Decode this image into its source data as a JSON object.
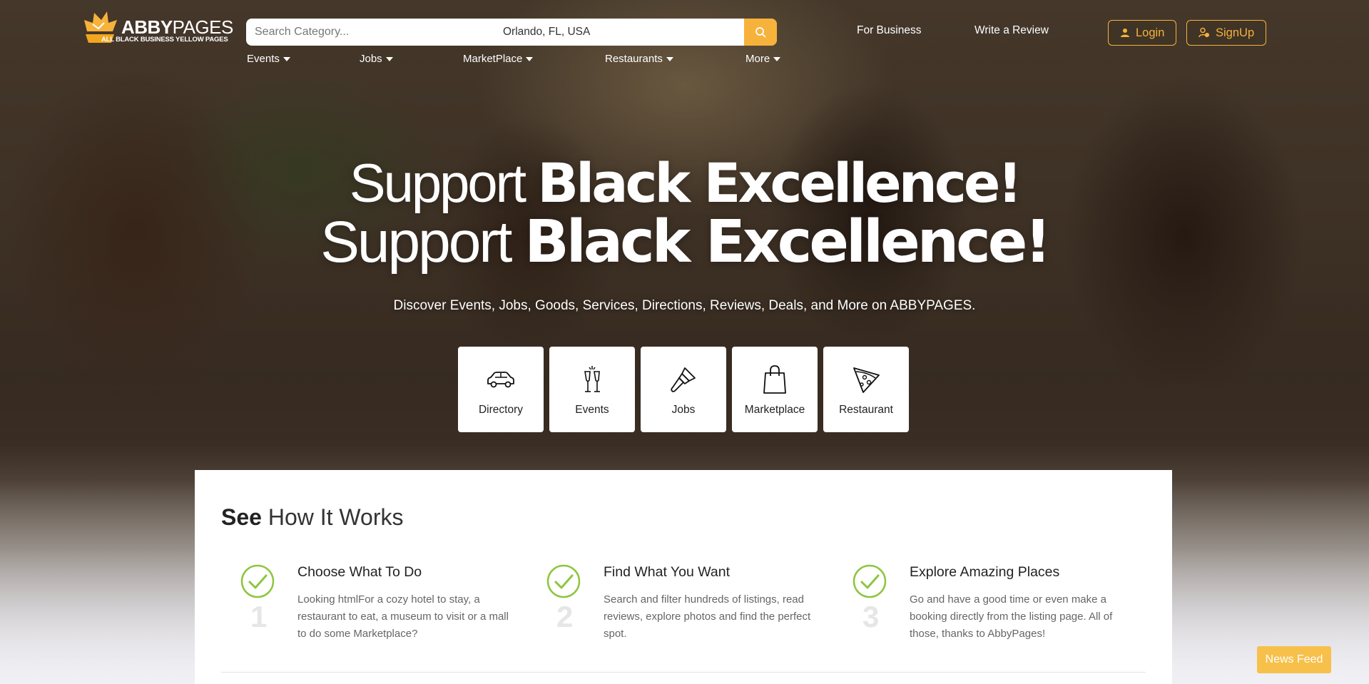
{
  "header": {
    "logo": {
      "bold": "ABBY",
      "light": "PAGES",
      "tagline": "ALL BLACK BUSINESS YELLOW PAGES"
    },
    "search": {
      "placeholder": "Search Category...",
      "location": "Orlando, FL, USA",
      "button_icon": "search-icon"
    },
    "links": {
      "for_business": "For Business",
      "write_review": "Write a Review"
    },
    "auth": {
      "login": "Login",
      "signup": "SignUp"
    },
    "nav": [
      {
        "label": "Events"
      },
      {
        "label": "Jobs"
      },
      {
        "label": "MarketPlace"
      },
      {
        "label": "Restaurants"
      },
      {
        "label": "More"
      }
    ]
  },
  "hero": {
    "line1": {
      "thin": "Support ",
      "bold": "Black Excellence!"
    },
    "line2": {
      "thin": "Support ",
      "bold": "Black Excellence!"
    },
    "subtitle": "Discover Events, Jobs, Goods, Services, Directions, Reviews, Deals, and More on ABBYPAGES.",
    "tiles": [
      {
        "label": "Directory",
        "icon": "car-icon"
      },
      {
        "label": "Events",
        "icon": "cheers-icon"
      },
      {
        "label": "Jobs",
        "icon": "paint-brush-icon"
      },
      {
        "label": "Marketplace",
        "icon": "shopping-bag-icon"
      },
      {
        "label": "Restaurant",
        "icon": "pizza-slice-icon"
      }
    ]
  },
  "how_it_works": {
    "title_bold": "See",
    "title_rest": "How It Works",
    "steps": [
      {
        "num": "1",
        "title": "Choose What To Do",
        "text": "Looking htmlFor a cozy hotel to stay, a restaurant to eat, a museum to visit or a mall to do some Marketplace?"
      },
      {
        "num": "2",
        "title": "Find What You Want",
        "text": "Search and filter hundreds of listings, read reviews, explore photos and find the perfect spot."
      },
      {
        "num": "3",
        "title": "Explore Amazing Places",
        "text": "Go and have a good time or even make a booking directly from the listing page. All of those, thanks to AbbyPages!"
      }
    ]
  },
  "news_feed": "News Feed",
  "colors": {
    "accent": "#f7b23b",
    "check_green": "#8dc63f"
  }
}
